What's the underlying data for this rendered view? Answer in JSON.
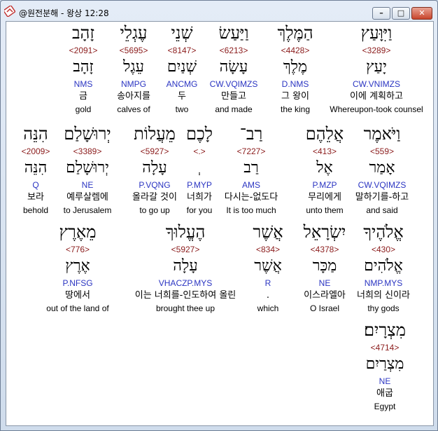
{
  "window": {
    "title": "@원전분해 - 왕상 12:28",
    "controls": {
      "minimize_glyph": "–",
      "maximize_glyph": "□",
      "close_glyph": "✕"
    },
    "icon": "bible-app-icon"
  },
  "rows": [
    {
      "words": [
        {
          "hebrew": "וַיִּוָּעַץ",
          "strong": "<3289>",
          "lexeme": "יָעַץ",
          "parse": "CW.VNIMZS",
          "korean": "이에 계획하고",
          "english": "Whereupon-took counsel"
        },
        {
          "hebrew": "הַמֶּלֶךְ",
          "strong": "<4428>",
          "lexeme": "מֶלֶךְ",
          "parse": "D.NMS",
          "korean": "그 왕이",
          "english": "the king"
        },
        {
          "hebrew": "וַיַּעַשׂ",
          "strong": "<6213>",
          "lexeme": "עָשָׂה",
          "parse": "CW.VQIMZS",
          "korean": "만들고",
          "english": "and made"
        },
        {
          "hebrew": "שְׁנֵי",
          "strong": "<8147>",
          "lexeme": "שְׁנַיִם",
          "parse": "ANCMG",
          "korean": "두",
          "english": "two"
        },
        {
          "hebrew": "עֶגְלֵי",
          "strong": "<5695>",
          "lexeme": "עֵגֶל",
          "parse": "NMPG",
          "korean": "송아지를",
          "english": "calves of"
        },
        {
          "hebrew": "זָהָב",
          "strong": "<2091>",
          "lexeme": "זָהָב",
          "parse": "NMS",
          "korean": "금",
          "english": "gold"
        }
      ]
    },
    {
      "words": [
        {
          "hebrew": "וַיֹּאמֶר",
          "strong": "<559>",
          "lexeme": "אָמַר",
          "parse": "CW.VQIMZS",
          "korean": "말하기를-하고",
          "english": "and said"
        },
        {
          "hebrew": "אֲלֵהֶם",
          "strong": "<413>",
          "lexeme": "אֶל",
          "parse": "P.MZP",
          "korean": "무리에게",
          "english": "unto them"
        },
        {
          "hebrew": "רַב־",
          "strong": "<7227>",
          "lexeme": "רַב",
          "parse": "AMS",
          "korean": "다시는-없도다",
          "english": "It is too much"
        },
        {
          "hebrew": "לָכֶם",
          "strong": "<.>",
          "lexeme": "ְ",
          "parse": "P.MYP",
          "korean": "너희가",
          "english": "for you"
        },
        {
          "hebrew": "מֵעֲלוֹת",
          "strong": "<5927>",
          "lexeme": "עָלָה",
          "parse": "P.VQNG",
          "korean": "올라갈 것이",
          "english": "to go up"
        },
        {
          "hebrew": "יְרוּשָׁלַם",
          "strong": "<3389>",
          "lexeme": "יְרוּשָׁלַם",
          "parse": "NE",
          "korean": "예루살렘에",
          "english": "to Jerusalem"
        },
        {
          "hebrew": "הִנֵּה",
          "strong": "<2009>",
          "lexeme": "הִנֵּה",
          "parse": "Q",
          "korean": "보라",
          "english": "behold"
        }
      ]
    },
    {
      "words": [
        {
          "hebrew": "אֱלֹהֶיךָ",
          "strong": "<430>",
          "lexeme": "אֱלֹהִים",
          "parse": "NMP.MYS",
          "korean": "너희의 신이라",
          "english": "thy gods"
        },
        {
          "hebrew": "יִשְׂרָאֵל",
          "strong": "<4378>",
          "lexeme": "מַכָּר",
          "parse": "NE",
          "korean": "이스라엘아",
          "english": "O Israel"
        },
        {
          "hebrew": "אֲשֶׁר",
          "strong": "<834>",
          "lexeme": "אֲשֶׁר",
          "parse": "R",
          "korean": ".",
          "english": "which"
        },
        {
          "hebrew": "הֶעֱלוּךָ",
          "strong": "<5927>",
          "lexeme": "עָלָה",
          "parse": "VHACZP.MYS",
          "korean": "이는 너희를-인도하여 올린",
          "english": "brought thee up"
        },
        {
          "hebrew": "מֵאֶרֶץ",
          "strong": "<776>",
          "lexeme": "אֶרֶץ",
          "parse": "P.NFSG",
          "korean": "땅에서",
          "english": "out of the land of"
        }
      ]
    },
    {
      "words": [
        {
          "hebrew": "מִצְרָיִם׃",
          "strong": "<4714>",
          "lexeme": "מִצְרַיִם",
          "parse": "NE",
          "korean": "애굽",
          "english": "Egypt"
        }
      ]
    }
  ]
}
